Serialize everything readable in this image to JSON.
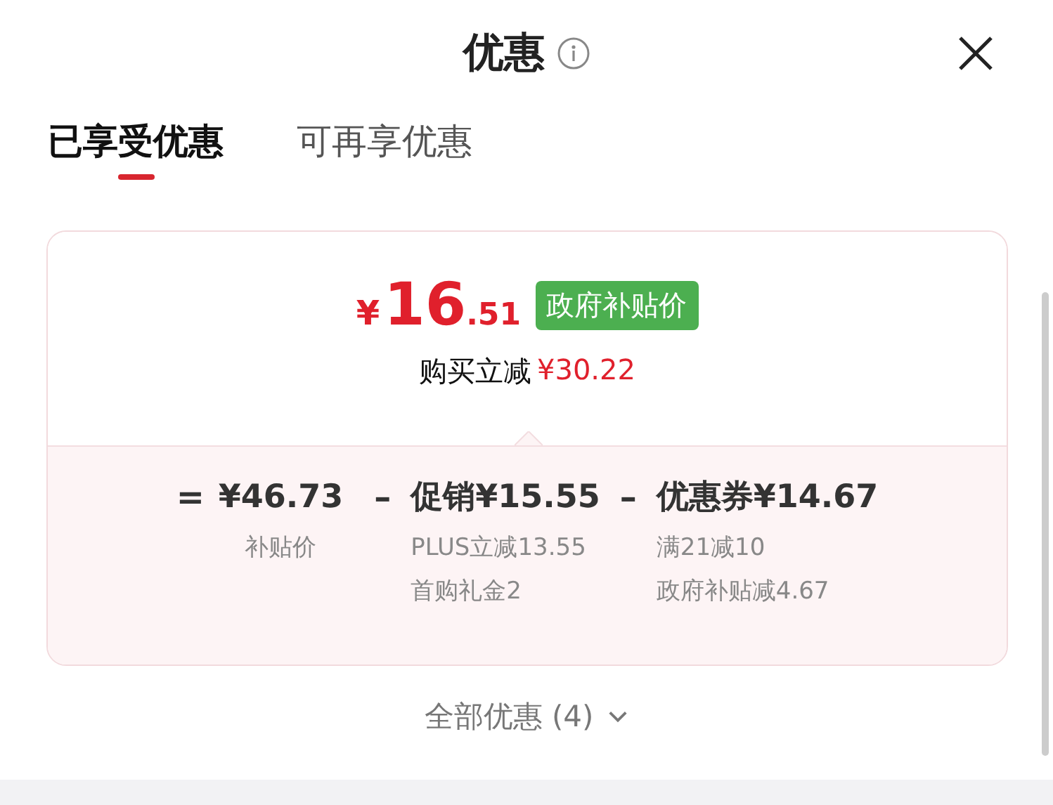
{
  "header": {
    "title": "优惠"
  },
  "tabs": [
    {
      "label": "已享受优惠",
      "selected": true
    },
    {
      "label": "可再享优惠",
      "selected": false
    }
  ],
  "card": {
    "price": {
      "currency": "¥",
      "integer": "16",
      "decimal": ".51"
    },
    "badge": "政府补贴价",
    "saving_label": "购买立减",
    "saving_amount": "¥30.22",
    "terms": [
      {
        "sign": "=",
        "title": "¥46.73",
        "notes": [
          "补贴价"
        ]
      },
      {
        "sign": "–",
        "title": "促销¥15.55",
        "notes": [
          "PLUS立减13.55",
          "首购礼金2"
        ]
      },
      {
        "sign": "–",
        "title": "优惠券¥14.67",
        "notes": [
          "满21减10",
          "政府补贴减4.67"
        ]
      }
    ]
  },
  "footer": {
    "label": "全部优惠 (4)"
  }
}
